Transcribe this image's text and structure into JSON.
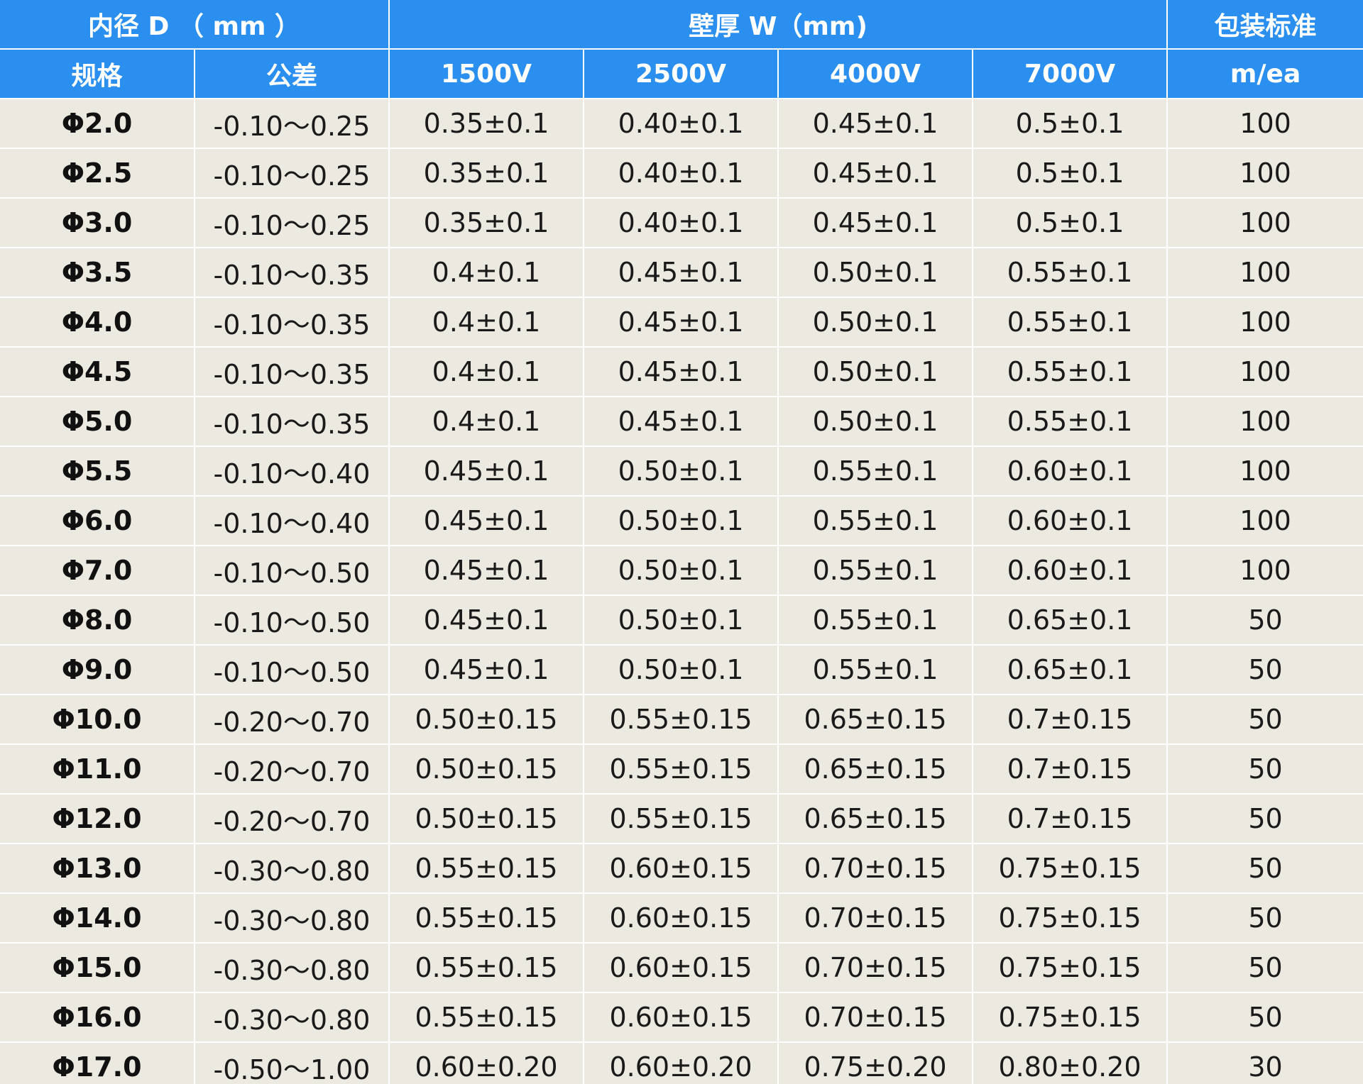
{
  "header": {
    "inner_diameter": "内径 D （ mm ）",
    "wall_thickness": "壁厚 W（mm)",
    "packaging": "包装标准",
    "spec": "规格",
    "tolerance": "公差",
    "v1500": "1500V",
    "v2500": "2500V",
    "v4000": "4000V",
    "v7000": "7000V",
    "unit": "m/ea"
  },
  "rows": [
    {
      "size": "Φ2.0",
      "tol": "-0.10～0.25",
      "w1500": "0.35±0.1",
      "w2500": "0.40±0.1",
      "w4000": "0.45±0.1",
      "w7000": "0.5±0.1",
      "pack": "100"
    },
    {
      "size": "Φ2.5",
      "tol": "-0.10～0.25",
      "w1500": "0.35±0.1",
      "w2500": "0.40±0.1",
      "w4000": "0.45±0.1",
      "w7000": "0.5±0.1",
      "pack": "100"
    },
    {
      "size": "Φ3.0",
      "tol": "-0.10～0.25",
      "w1500": "0.35±0.1",
      "w2500": "0.40±0.1",
      "w4000": "0.45±0.1",
      "w7000": "0.5±0.1",
      "pack": "100"
    },
    {
      "size": "Φ3.5",
      "tol": "-0.10～0.35",
      "w1500": "0.4±0.1",
      "w2500": "0.45±0.1",
      "w4000": "0.50±0.1",
      "w7000": "0.55±0.1",
      "pack": "100"
    },
    {
      "size": "Φ4.0",
      "tol": "-0.10～0.35",
      "w1500": "0.4±0.1",
      "w2500": "0.45±0.1",
      "w4000": "0.50±0.1",
      "w7000": "0.55±0.1",
      "pack": "100"
    },
    {
      "size": "Φ4.5",
      "tol": "-0.10～0.35",
      "w1500": "0.4±0.1",
      "w2500": "0.45±0.1",
      "w4000": "0.50±0.1",
      "w7000": "0.55±0.1",
      "pack": "100"
    },
    {
      "size": "Φ5.0",
      "tol": "-0.10～0.35",
      "w1500": "0.4±0.1",
      "w2500": "0.45±0.1",
      "w4000": "0.50±0.1",
      "w7000": "0.55±0.1",
      "pack": "100"
    },
    {
      "size": "Φ5.5",
      "tol": "-0.10～0.40",
      "w1500": "0.45±0.1",
      "w2500": "0.50±0.1",
      "w4000": "0.55±0.1",
      "w7000": "0.60±0.1",
      "pack": "100"
    },
    {
      "size": "Φ6.0",
      "tol": "-0.10～0.40",
      "w1500": "0.45±0.1",
      "w2500": "0.50±0.1",
      "w4000": "0.55±0.1",
      "w7000": "0.60±0.1",
      "pack": "100"
    },
    {
      "size": "Φ7.0",
      "tol": "-0.10～0.50",
      "w1500": "0.45±0.1",
      "w2500": "0.50±0.1",
      "w4000": "0.55±0.1",
      "w7000": "0.60±0.1",
      "pack": "100"
    },
    {
      "size": "Φ8.0",
      "tol": "-0.10～0.50",
      "w1500": "0.45±0.1",
      "w2500": "0.50±0.1",
      "w4000": "0.55±0.1",
      "w7000": "0.65±0.1",
      "pack": "50"
    },
    {
      "size": "Φ9.0",
      "tol": "-0.10～0.50",
      "w1500": "0.45±0.1",
      "w2500": "0.50±0.1",
      "w4000": "0.55±0.1",
      "w7000": "0.65±0.1",
      "pack": "50"
    },
    {
      "size": "Φ10.0",
      "tol": "-0.20～0.70",
      "w1500": "0.50±0.15",
      "w2500": "0.55±0.15",
      "w4000": "0.65±0.15",
      "w7000": "0.7±0.15",
      "pack": "50"
    },
    {
      "size": "Φ11.0",
      "tol": "-0.20～0.70",
      "w1500": "0.50±0.15",
      "w2500": "0.55±0.15",
      "w4000": "0.65±0.15",
      "w7000": "0.7±0.15",
      "pack": "50"
    },
    {
      "size": "Φ12.0",
      "tol": "-0.20～0.70",
      "w1500": "0.50±0.15",
      "w2500": "0.55±0.15",
      "w4000": "0.65±0.15",
      "w7000": "0.7±0.15",
      "pack": "50"
    },
    {
      "size": "Φ13.0",
      "tol": "-0.30～0.80",
      "w1500": "0.55±0.15",
      "w2500": "0.60±0.15",
      "w4000": "0.70±0.15",
      "w7000": "0.75±0.15",
      "pack": "50"
    },
    {
      "size": "Φ14.0",
      "tol": "-0.30～0.80",
      "w1500": "0.55±0.15",
      "w2500": "0.60±0.15",
      "w4000": "0.70±0.15",
      "w7000": "0.75±0.15",
      "pack": "50"
    },
    {
      "size": "Φ15.0",
      "tol": "-0.30～0.80",
      "w1500": "0.55±0.15",
      "w2500": "0.60±0.15",
      "w4000": "0.70±0.15",
      "w7000": "0.75±0.15",
      "pack": "50"
    },
    {
      "size": "Φ16.0",
      "tol": "-0.30～0.80",
      "w1500": "0.55±0.15",
      "w2500": "0.60±0.15",
      "w4000": "0.70±0.15",
      "w7000": "0.75±0.15",
      "pack": "50"
    },
    {
      "size": "Φ17.0",
      "tol": "-0.50～1.00",
      "w1500": "0.60±0.20",
      "w2500": "0.60±0.20",
      "w4000": "0.75±0.20",
      "w7000": "0.80±0.20",
      "pack": "30"
    }
  ],
  "colors": {
    "header_bg": "#2b8ff0",
    "header_text": "#ffffff",
    "body_bg": "#eceae0",
    "body_text": "#1a1a1a"
  }
}
